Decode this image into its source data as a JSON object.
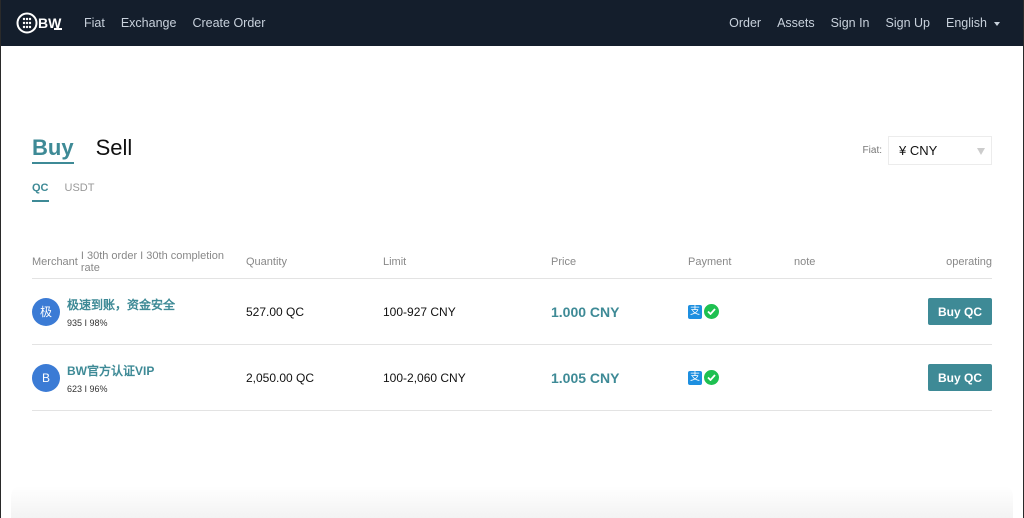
{
  "nav": {
    "logo_text": "BW",
    "left_links": [
      "Fiat",
      "Exchange",
      "Create Order"
    ],
    "right_links": [
      "Order",
      "Assets",
      "Sign In",
      "Sign Up"
    ],
    "language": "English"
  },
  "trade_tabs": {
    "buy": "Buy",
    "sell": "Sell",
    "active": "Buy"
  },
  "coin_tabs": [
    {
      "label": "QC",
      "active": true
    },
    {
      "label": "USDT",
      "active": false
    }
  ],
  "fiat": {
    "label": "Fiat:",
    "selected": "¥ CNY"
  },
  "table": {
    "headers": {
      "merchant": "Merchant",
      "merchant_sub": "I 30th order I 30th completion rate",
      "quantity": "Quantity",
      "limit": "Limit",
      "price": "Price",
      "payment": "Payment",
      "note": "note",
      "operating": "operating"
    },
    "rows": [
      {
        "avatar": "极",
        "name": "极速到账，资金安全",
        "stats": "935 I 98%",
        "quantity": "527.00 QC",
        "limit": "100-927 CNY",
        "price": "1.000 CNY",
        "payment": [
          "alipay-icon",
          "wechat-icon"
        ],
        "note": "",
        "action": "Buy QC"
      },
      {
        "avatar": "B",
        "name": "BW官方认证VIP",
        "stats": "623 I 96%",
        "quantity": "2,050.00 QC",
        "limit": "100-2,060 CNY",
        "price": "1.005 CNY",
        "payment": [
          "alipay-icon",
          "wechat-icon"
        ],
        "note": "",
        "action": "Buy QC"
      }
    ]
  },
  "colors": {
    "accent": "#3e8a96",
    "nav_bg": "#141e2c",
    "avatar": "#3b7bd5",
    "alipay": "#1d8fe0",
    "wechat": "#1ec051"
  },
  "icons": {
    "alipay": "支",
    "wechat_check": "✓"
  }
}
